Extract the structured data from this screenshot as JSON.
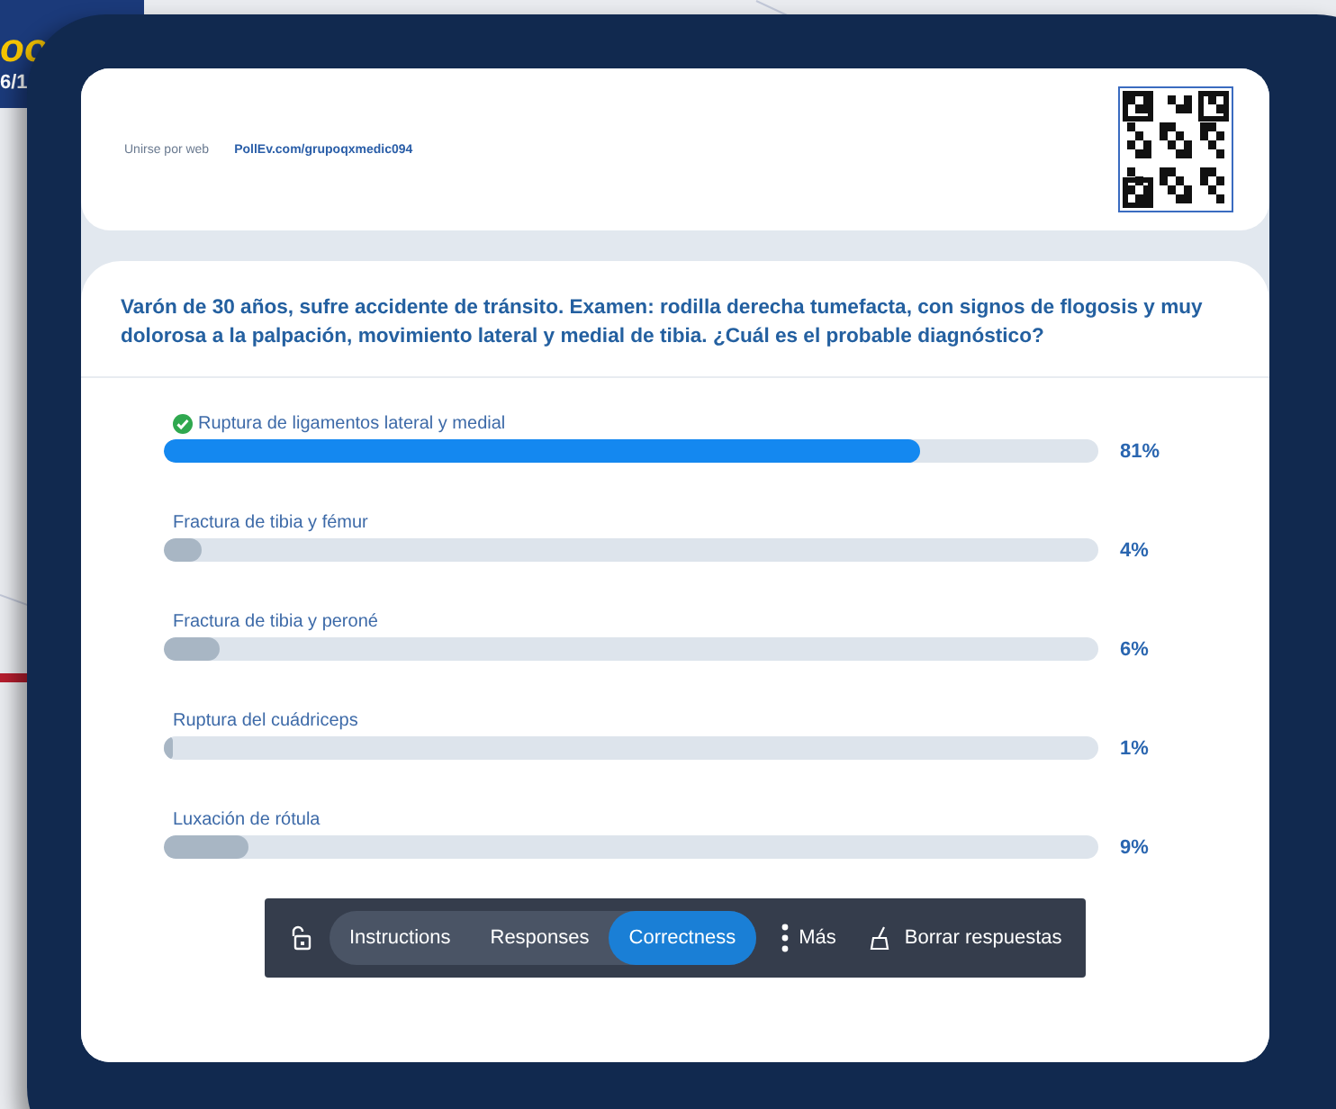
{
  "background_slide": {
    "title_fragment": "oo",
    "date_fragment": "6/1"
  },
  "join": {
    "label": "Unirse por web",
    "url": "PollEv.com/grupoqxmedic094"
  },
  "question": "Varón de 30 años, sufre accidente de tránsito. Examen: rodilla derecha tumefacta, con signos de flogosis y muy dolorosa a la palpación, movimiento lateral y medial de tibia. ¿Cuál es el probable diagnóstico?",
  "options": [
    {
      "label": "Ruptura de ligamentos lateral y medial",
      "correct": true,
      "level": 0.81,
      "percent": "81%"
    },
    {
      "label": "Fractura de tibia y fémur",
      "correct": false,
      "level": 0.04,
      "percent": "4%"
    },
    {
      "label": "Fractura de tibia y peroné",
      "correct": false,
      "level": 0.06,
      "percent": "6%"
    },
    {
      "label": "Ruptura del cuádriceps",
      "correct": false,
      "level": 0.01,
      "percent": "1%"
    },
    {
      "label": "Luxación de rótula",
      "correct": false,
      "level": 0.09,
      "percent": "9%"
    }
  ],
  "toolbar": {
    "tabs": [
      {
        "label": "Instructions",
        "selected": false
      },
      {
        "label": "Responses",
        "selected": false
      },
      {
        "label": "Correctness",
        "selected": true
      }
    ],
    "more": "Más",
    "clear": "Borrar respuestas"
  }
}
